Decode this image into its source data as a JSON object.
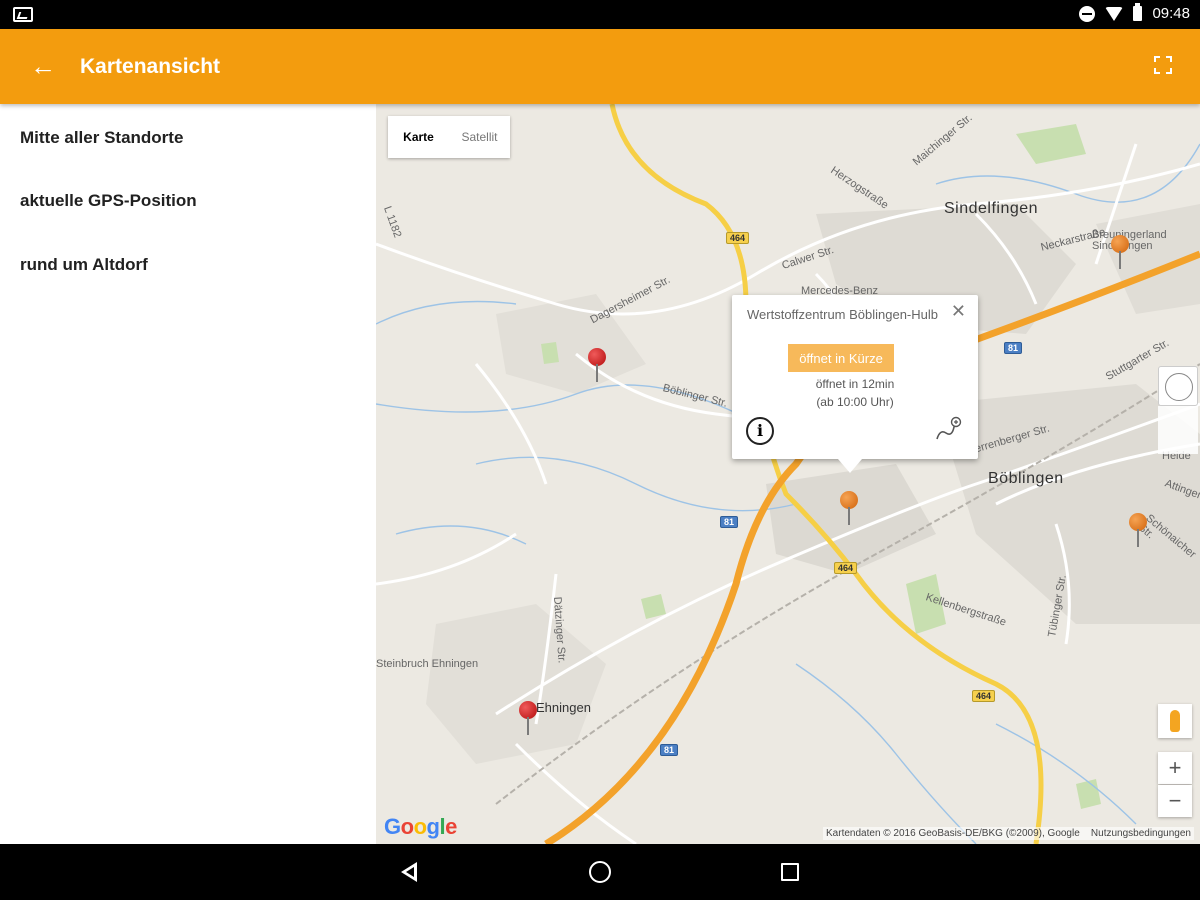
{
  "status_bar": {
    "time": "09:48",
    "icons": [
      "photo-notification-icon",
      "do-not-disturb-icon",
      "wifi-icon",
      "battery-icon"
    ]
  },
  "app_bar": {
    "title": "Kartenansicht",
    "back_icon": "arrow-back-icon",
    "fullscreen_icon": "fullscreen-icon",
    "color": "#f39c0e"
  },
  "sidebar": {
    "items": [
      {
        "label": "Mitte aller Standorte"
      },
      {
        "label": "aktuelle GPS-Position"
      },
      {
        "label": "rund um Altdorf"
      }
    ]
  },
  "map": {
    "map_type": {
      "map_label": "Karte",
      "satellite_label": "Satellit",
      "selected": "Karte"
    },
    "places": {
      "sindelfingen": "Sindelfingen",
      "boeblingen": "Böblingen",
      "ehningen": "Ehningen",
      "steinbruch": "Steinbruch Ehningen",
      "mercedes": "Mercedes-Benz",
      "breuninger": "Breuningerland Sindelfingen",
      "herrenberger": "Herrenberger Str.",
      "boeblinger": "Böblinger Str.",
      "calwer": "Calwer Str.",
      "darmsheimer": "Dagersheimer Str.",
      "daitinger": "Dätzinger Str.",
      "stuttgarter": "Stuttgarter Str.",
      "schoenaicher": "Schönaicher Str.",
      "felsenberg": "Kellenbergstraße",
      "tubinger": "Tübinger Str.",
      "maichinger": "Maichinger Str.",
      "herzog": "Herzogstraße",
      "neckar": "Neckarstraße",
      "l1182": "L 1182",
      "heide": "Heide",
      "attingen": "Attingen"
    },
    "road_shields": {
      "b464_a": "464",
      "b464_b": "464",
      "b464_c": "464",
      "a81_a": "81",
      "a81_b": "81",
      "a81_c": "81"
    },
    "popup": {
      "name": "Wertstoffzentrum Böblingen-Hulb",
      "status": "öffnet in Kürze",
      "opens_in": "öffnet in 12min",
      "opens_at": "(ab 10:00 Uhr)",
      "status_color": "#f7b95a"
    },
    "zoom_in_label": "+",
    "zoom_out_label": "−",
    "google_logo": "Google",
    "attribution": "Kartendaten © 2016 GeoBasis-DE/BKG (©2009), Google",
    "terms_label": "Nutzungsbedingungen"
  },
  "nav_bar": {
    "icons": [
      "nav-back-icon",
      "nav-home-icon",
      "nav-recents-icon"
    ]
  }
}
